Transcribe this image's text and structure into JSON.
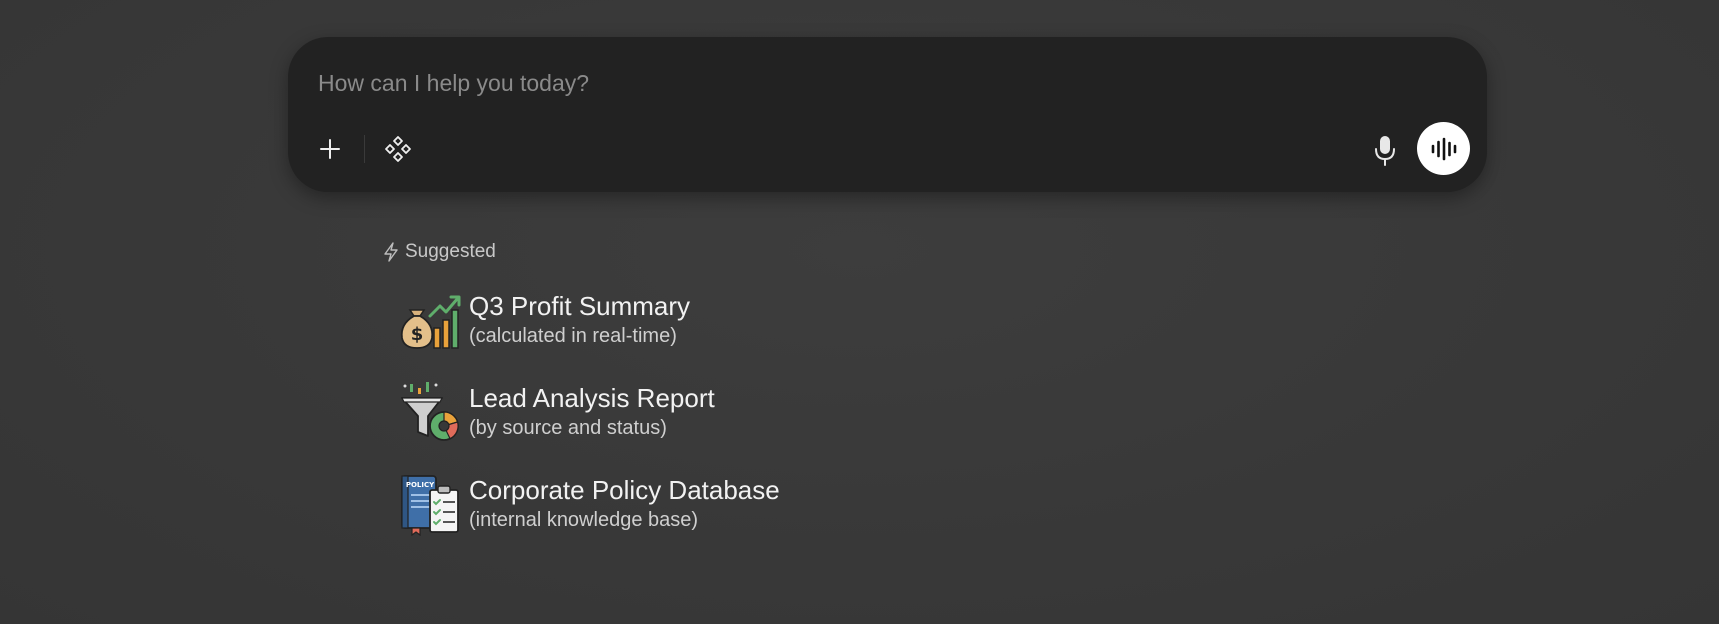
{
  "composer": {
    "placeholder": "How can I help you today?",
    "value": ""
  },
  "suggested": {
    "label": "Suggested",
    "items": [
      {
        "title": "Q3 Profit Summary",
        "subtitle": "(calculated in real-time)",
        "icon": "money-bag-chart-icon"
      },
      {
        "title": "Lead Analysis Report",
        "subtitle": "(by source and status)",
        "icon": "funnel-chart-icon"
      },
      {
        "title": "Corporate Policy Database",
        "subtitle": "(internal knowledge base)",
        "icon": "policy-book-checklist-icon"
      }
    ],
    "policy_badge": "POLICY"
  },
  "colors": {
    "background": "#393939",
    "composer": "#222222",
    "voice_button": "#ffffff"
  }
}
